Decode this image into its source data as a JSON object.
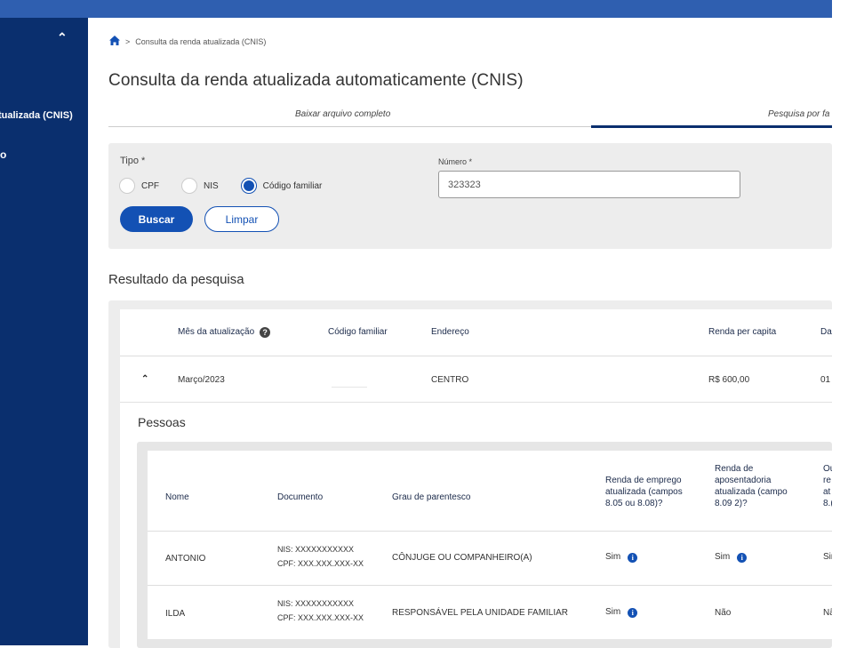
{
  "sidebar": {
    "collapse_icon": "chevron-up-icon",
    "item_active": "tualizada (CNIS)",
    "item_other": "o"
  },
  "breadcrumb": {
    "home_icon": "home-icon",
    "separator": ">",
    "current": "Consulta da renda atualizada (CNIS)"
  },
  "page": {
    "title": "Consulta da renda atualizada automaticamente (CNIS)"
  },
  "tabs": [
    {
      "label": "Baixar arquivo completo",
      "active": false
    },
    {
      "label": "Pesquisa por fa",
      "active": true
    }
  ],
  "filter": {
    "tipo_label": "Tipo *",
    "options": [
      {
        "label": "CPF",
        "selected": false
      },
      {
        "label": "NIS",
        "selected": false
      },
      {
        "label": "Código familiar",
        "selected": true
      }
    ],
    "numero_label": "Número *",
    "numero_value": "323323",
    "buscar_label": "Buscar",
    "limpar_label": "Limpar"
  },
  "result": {
    "title": "Resultado da pesquisa",
    "headers": {
      "mes": "Mês da atualização",
      "codigo": "Código familiar",
      "endereco": "Endereço",
      "renda": "Renda per capita",
      "data": "Da"
    },
    "row": {
      "mes": "Março/2023",
      "codigo": "",
      "endereco": "CENTRO",
      "renda": "R$ 600,00",
      "data": "01"
    }
  },
  "pessoas": {
    "title": "Pessoas",
    "headers": {
      "nome": "Nome",
      "documento": "Documento",
      "grau": "Grau de parentesco",
      "emprego": [
        "Renda de emprego",
        "atualizada (campos",
        "8.05 ou 8.08)?"
      ],
      "aposentadoria": [
        "Renda de",
        "aposentadoria",
        "atualizada (campo",
        "8.09 2)?"
      ],
      "outras": [
        "Ou",
        "re",
        "at",
        "8.("
      ]
    },
    "rows": [
      {
        "nome": "ANTONIO",
        "nis": "NIS: XXXXXXXXXXX",
        "cpf": "CPF: XXX.XXX.XXX-XX",
        "grau": "CÔNJUGE OU COMPANHEIRO(A)",
        "emprego": "Sim",
        "aposentadoria": "Sim",
        "outras": "Sir"
      },
      {
        "nome": "ILDA",
        "nis": "NIS: XXXXXXXXXXX",
        "cpf": "CPF: XXX.XXX.XXX-XX",
        "grau": "RESPONSÁVEL PELA UNIDADE FAMILIAR",
        "emprego": "Sim",
        "aposentadoria": "Não",
        "outras": "Nã"
      }
    ]
  },
  "colors": {
    "primary": "#1351b4",
    "sidebar": "#0a2f6e",
    "topbar": "#2f5fb0"
  }
}
